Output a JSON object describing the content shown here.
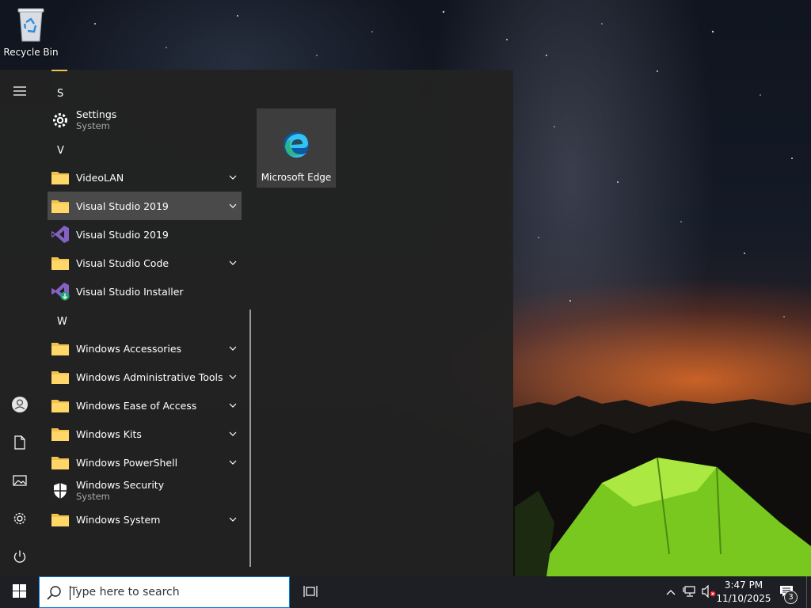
{
  "desktop": {
    "icons": [
      {
        "label": "Recycle Bin",
        "icon": "recycle-bin-icon"
      }
    ]
  },
  "start_menu": {
    "rail": {
      "hamburger": "hamburger-menu-icon",
      "bottom": [
        "user-icon",
        "documents-icon",
        "pictures-icon",
        "settings-icon",
        "power-icon"
      ]
    },
    "sections": [
      {
        "letter": "S",
        "apps": [
          {
            "name": "Settings",
            "sub": "System",
            "icon": "gear-icon",
            "expandable": false
          }
        ]
      },
      {
        "letter": "V",
        "apps": [
          {
            "name": "VideoLAN",
            "icon": "folder-icon",
            "expandable": true
          },
          {
            "name": "Visual Studio 2019",
            "icon": "folder-icon",
            "expandable": true,
            "selected": true
          },
          {
            "name": "Visual Studio 2019",
            "icon": "visual-studio-icon",
            "expandable": false
          },
          {
            "name": "Visual Studio Code",
            "icon": "folder-icon",
            "expandable": true
          },
          {
            "name": "Visual Studio Installer",
            "icon": "visual-studio-installer-icon",
            "expandable": false
          }
        ]
      },
      {
        "letter": "W",
        "apps": [
          {
            "name": "Windows Accessories",
            "icon": "folder-icon",
            "expandable": true
          },
          {
            "name": "Windows Administrative Tools",
            "icon": "folder-icon",
            "expandable": true
          },
          {
            "name": "Windows Ease of Access",
            "icon": "folder-icon",
            "expandable": true
          },
          {
            "name": "Windows Kits",
            "icon": "folder-icon",
            "expandable": true
          },
          {
            "name": "Windows PowerShell",
            "icon": "folder-icon",
            "expandable": true
          },
          {
            "name": "Windows Security",
            "sub": "System",
            "icon": "shield-icon",
            "expandable": false
          },
          {
            "name": "Windows System",
            "icon": "folder-icon",
            "expandable": true
          }
        ]
      }
    ],
    "tiles": [
      {
        "label": "Microsoft Edge",
        "icon": "edge-icon"
      }
    ]
  },
  "taskbar": {
    "start_icon": "windows-logo-icon",
    "search": {
      "placeholder": "Type here to search",
      "icon": "search-icon"
    },
    "task_view_icon": "task-view-icon",
    "tray": {
      "icons": [
        "chevron-up-icon",
        "network-icon",
        "volume-muted-icon"
      ],
      "time": "3:47 PM",
      "date": "11/10/2025",
      "notification_count": "3"
    }
  },
  "colors": {
    "start_bg": "#222222",
    "taskbar_bg": "#1d1f24",
    "folder": "#f2c14e",
    "accent": "#0078d7",
    "selected_row": "#4a4a4a"
  }
}
